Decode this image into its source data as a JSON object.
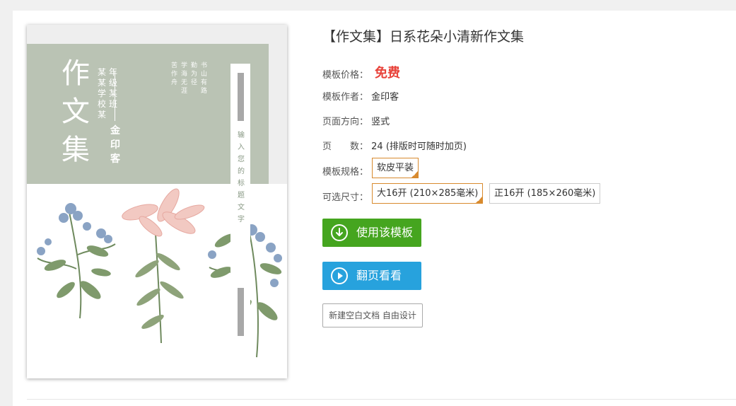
{
  "template": {
    "title": "【作文集】日系花朵小清新作文集",
    "price_label": "模板价格：",
    "price_value": "免费",
    "author_label": "模板作者：",
    "author_value": "金印客",
    "orientation_label": "页面方向：",
    "orientation_value": "竖式",
    "pages_label": "页　　数：",
    "pages_value": "24 (排版时可随时加页)",
    "spec_label": "模板规格：",
    "spec_options": [
      "软皮平装"
    ],
    "size_label": "可选尺寸：",
    "size_options": [
      "大16开 (210×285毫米)",
      "正16开 (185×260毫米)"
    ],
    "selected_size": "大16开 (210×285毫米)"
  },
  "actions": {
    "use_template": "使用该模板",
    "flip_preview": "翻页看看",
    "new_blank": "新建空白文档 自由设计"
  },
  "cover": {
    "main_title": "作文集",
    "school_line1": "某某学校某",
    "school_line2": "年级某班",
    "author": "金印客",
    "poem_col1": "书山有路",
    "poem_col2": "勤为径",
    "poem_col3": "学海无涯",
    "poem_col4": "苦作舟",
    "ribbon_text": "输入您的标题文字"
  },
  "colors": {
    "accent_green": "#45a51f",
    "accent_blue": "#27a2dd",
    "price_red": "#e8423a",
    "selected_border": "#d88a2e",
    "cover_green": "#bac3b4"
  },
  "icons": {
    "use_template": "download-circle-icon",
    "flip_preview": "play-circle-icon",
    "selected_mark": "check-corner-icon"
  }
}
